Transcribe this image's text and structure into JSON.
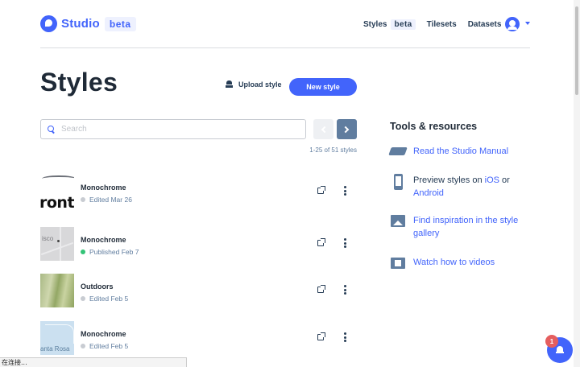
{
  "header": {
    "logo_text": "Studio",
    "logo_beta": "beta",
    "nav": [
      {
        "label": "Styles",
        "badge": "beta"
      },
      {
        "label": "Tilesets"
      },
      {
        "label": "Datasets"
      }
    ]
  },
  "page": {
    "title": "Styles",
    "upload_label": "Upload style",
    "new_label": "New style"
  },
  "search": {
    "placeholder": "Search",
    "value": ""
  },
  "pager": {
    "count_text": "1-25 of 51 styles"
  },
  "styles": [
    {
      "name": "Monochrome",
      "status": "Edited Mar 26",
      "status_color": "#c8ccd2",
      "thumb_text": "ront"
    },
    {
      "name": "Monochrome",
      "status": "Published Feb 7",
      "status_color": "#33c377",
      "thumb_text": "isco"
    },
    {
      "name": "Outdoors",
      "status": "Edited Feb 5",
      "status_color": "#c8ccd2"
    },
    {
      "name": "Monochrome",
      "status": "Edited Feb 5",
      "status_color": "#c8ccd2",
      "thumb_text": "anta Rosa"
    }
  ],
  "tools": {
    "title": "Tools & resources",
    "manual": "Read the Studio Manual",
    "preview_prefix": "Preview styles on ",
    "preview_ios": "iOS",
    "preview_or": " or",
    "preview_android": "Android",
    "gallery": "Find inspiration in the style gallery",
    "videos": "Watch how to videos"
  },
  "status_bar": {
    "text": "在连接..."
  },
  "notifications": {
    "count": "1"
  },
  "colors": {
    "accent": "#4264fb",
    "published": "#33c377",
    "badge": "#e55e5e"
  }
}
